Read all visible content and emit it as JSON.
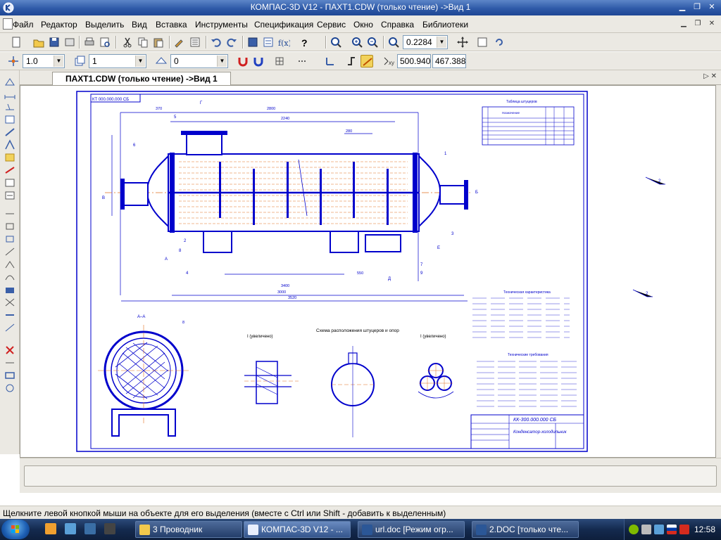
{
  "window": {
    "title": "КОМПАС-3D V12 - ПАХТ1.CDW (только чтение) ->Вид 1"
  },
  "menu": [
    "Файл",
    "Редактор",
    "Выделить",
    "Вид",
    "Вставка",
    "Инструменты",
    "Спецификация",
    "Сервис",
    "Окно",
    "Справка",
    "Библиотеки"
  ],
  "toolbar1": {
    "zoom_value": "0.2284"
  },
  "toolbar2": {
    "line_scale": "1.0",
    "layer": "1",
    "state": "0",
    "coord_x": "500.940",
    "coord_y": "467.388"
  },
  "doc_tab": {
    "label": "ПАХТ1.CDW (только чтение) ->Вид 1"
  },
  "drawing": {
    "top_stamp": "КТ 000.000.000 СБ",
    "section_aa": "А–А",
    "detail_left": "I (увеличено)",
    "detail_right": "I (увеличено)",
    "nozzle_scheme": "Схема расположения штуцеров и опор",
    "title_block_number": "КК-300.000.000 СБ",
    "title_block_name": "Конденсатор-холодильник",
    "tech_req_title": "Технические требования",
    "tech_char_title": "Техническая характеристика",
    "nozzle_table_title": "Таблица штуцеров",
    "nozzle_table_header": "Назначение",
    "dim_2240": "2240",
    "dim_2800": "2800",
    "dim_3400": "3400",
    "dim_3000": "3000",
    "dim_3520": "3520",
    "dim_370": "370",
    "dim_280": "280",
    "dim_550": "550",
    "letter_b": "Б",
    "letter_v": "В",
    "letter_a": "А",
    "letter_g": "Г",
    "letter_d": "Д",
    "letter_e": "Е",
    "num_1": "1",
    "num_2": "2",
    "num_3": "3",
    "num_4": "4",
    "num_5": "5",
    "num_6": "6",
    "num_7": "7",
    "num_8": "8",
    "num_9": "9",
    "side_2a": "2",
    "side_2b": "2"
  },
  "status": {
    "text": "Щелкните левой кнопкой мыши на объекте для его выделения (вместе с Ctrl или Shift - добавить к выделенным)"
  },
  "taskbar": {
    "tasks": [
      "3 Проводник",
      "КОМПАС-3D V12 - ...",
      "url.doc [Режим огр...",
      "2.DOC [только чте..."
    ],
    "clock": "12:58"
  },
  "colors": {
    "accent": "#1d4694",
    "drawing_blue": "#0000cc",
    "axis_orange": "#e07020"
  }
}
